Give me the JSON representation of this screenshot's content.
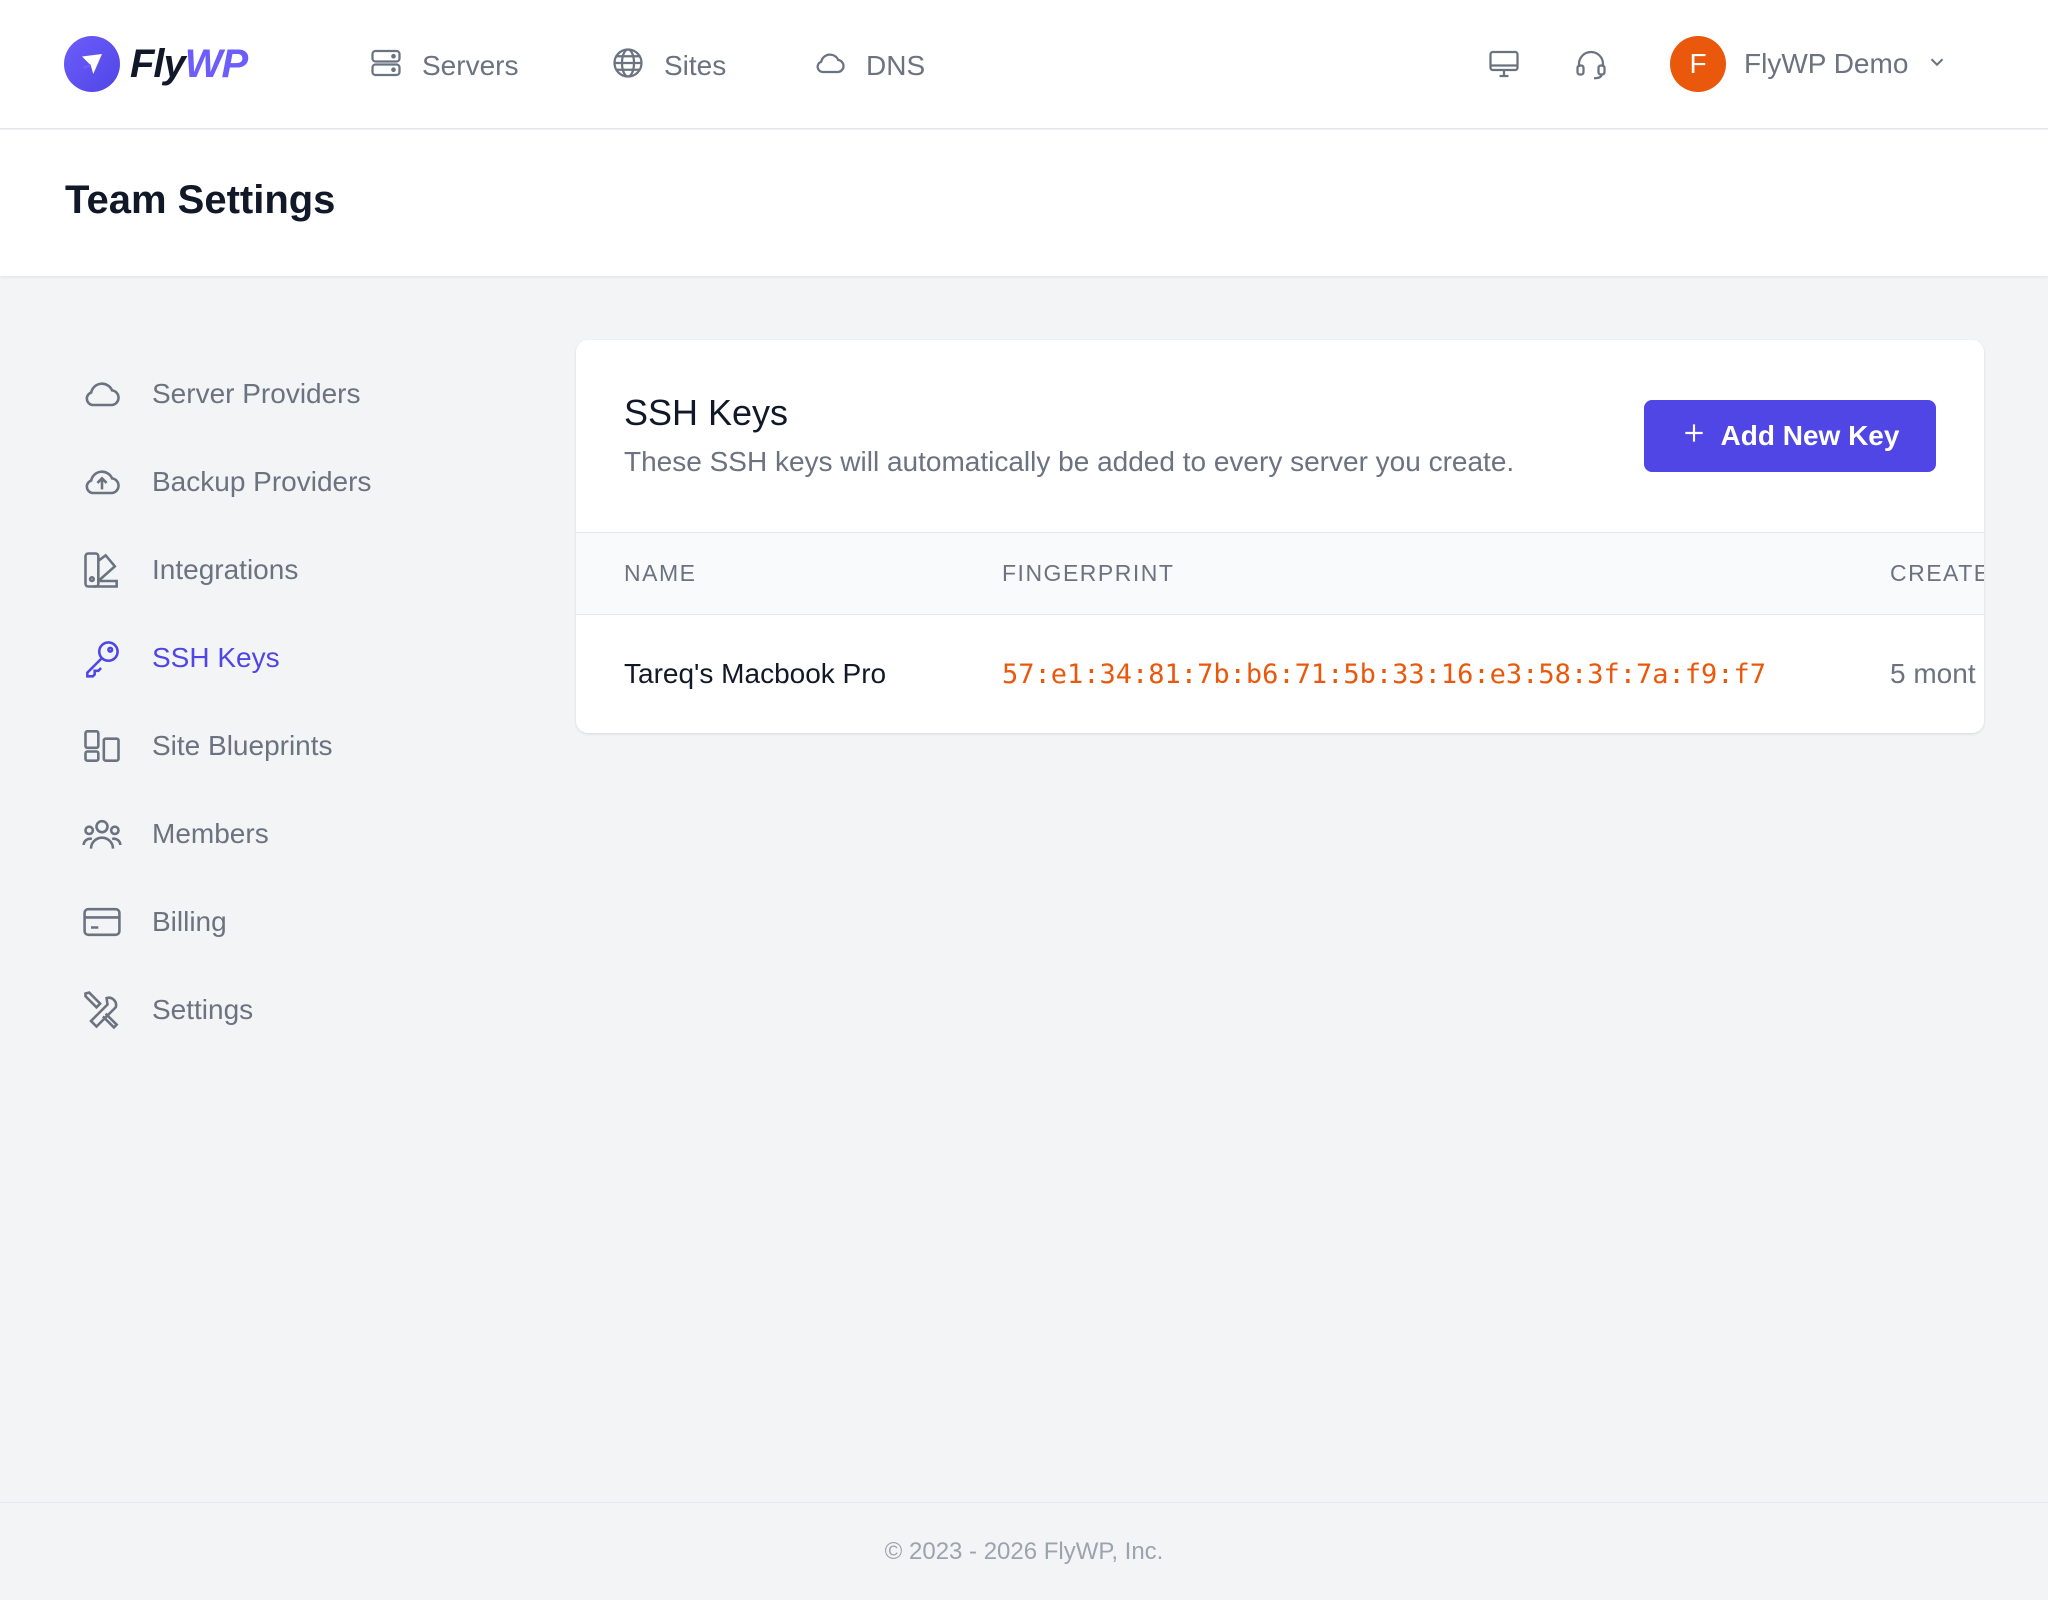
{
  "brand": {
    "name_part1": "Fly",
    "name_part2": "WP",
    "accent": "#4f46e5",
    "warning": "#ea580c"
  },
  "nav": {
    "links": [
      {
        "label": "Servers",
        "icon": "server-icon"
      },
      {
        "label": "Sites",
        "icon": "globe-icon"
      },
      {
        "label": "DNS",
        "icon": "cloud-icon"
      }
    ],
    "icons": [
      "monitor-icon",
      "headset-icon"
    ],
    "user": {
      "initial": "F",
      "name": "FlyWP Demo"
    }
  },
  "page": {
    "title": "Team Settings"
  },
  "sidebar": {
    "items": [
      {
        "label": "Server Providers",
        "icon": "cloud-icon",
        "active": false
      },
      {
        "label": "Backup Providers",
        "icon": "cloud-upload-icon",
        "active": false
      },
      {
        "label": "Integrations",
        "icon": "swatch-icon",
        "active": false
      },
      {
        "label": "SSH Keys",
        "icon": "key-icon",
        "active": true
      },
      {
        "label": "Site Blueprints",
        "icon": "blueprint-icon",
        "active": false
      },
      {
        "label": "Members",
        "icon": "users-icon",
        "active": false
      },
      {
        "label": "Billing",
        "icon": "credit-card-icon",
        "active": false
      },
      {
        "label": "Settings",
        "icon": "wrench-screwdriver-icon",
        "active": false
      }
    ]
  },
  "ssh": {
    "title": "SSH Keys",
    "description": "These SSH keys will automatically be added to every server you create.",
    "add_button": "Add New Key",
    "columns": [
      "NAME",
      "FINGERPRINT",
      "CREATE"
    ],
    "rows": [
      {
        "name": "Tareq's Macbook Pro",
        "fingerprint": "57:e1:34:81:7b:b6:71:5b:33:16:e3:58:3f:7a:f9:f7",
        "created": "5 mont"
      }
    ]
  },
  "footer": {
    "text": "© 2023 - 2026 FlyWP, Inc."
  }
}
